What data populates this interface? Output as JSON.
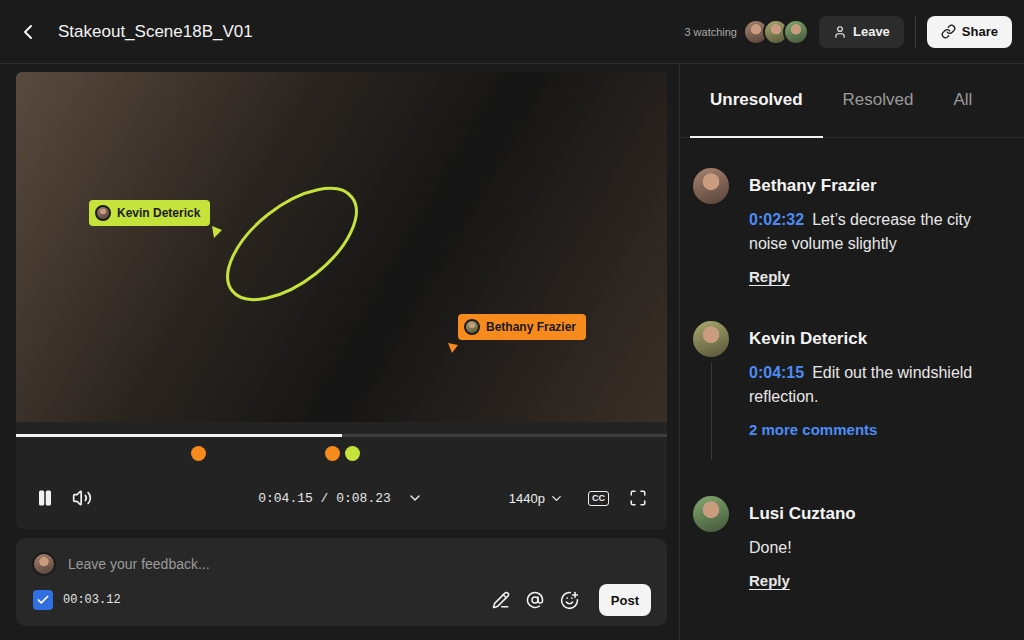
{
  "window": {
    "title": "Stakeout_Scene18B_V01"
  },
  "presence": {
    "label": "3 watching",
    "avatar_count": 3
  },
  "header_buttons": {
    "leave": "Leave",
    "share": "Share"
  },
  "video": {
    "annotations": [
      {
        "author": "Kevin Deterick",
        "color": "#c6e33b",
        "kind": "drawing"
      },
      {
        "author": "Bethany Frazier",
        "color": "#f78a1d",
        "kind": "pin"
      }
    ],
    "progress": {
      "level": 0.5
    },
    "markers": [
      {
        "color": "#f78a1d",
        "level": 0.28
      },
      {
        "color": "#f78a1d",
        "level": 0.485
      },
      {
        "color": "#c6e33b",
        "level": 0.516
      }
    ],
    "playing": true,
    "muted": false,
    "time": "0:04.15 / 0:08.23",
    "quality": "1440p",
    "captions": "CC"
  },
  "feedback": {
    "placeholder": "Leave your feedback...",
    "timestamp_enabled": true,
    "timestamp": "00:03.12",
    "post": "Post"
  },
  "tabs": [
    {
      "label": "Unresolved",
      "selected": true
    },
    {
      "label": "Resolved",
      "selected": false
    },
    {
      "label": "All",
      "selected": false
    }
  ],
  "comments": [
    {
      "author": "Bethany Frazier",
      "time": "0:02:32",
      "text": "Let’s decrease the city noise volume slightly",
      "reply": "Reply",
      "more": "",
      "replies": []
    },
    {
      "author": "Kevin Deterick",
      "time": "0:04:15",
      "text": "Edit out the windshield reflection.",
      "reply": "",
      "more": "2 more comments",
      "replies": [
        {
          "author": "Lusi Cuztano",
          "time": "",
          "text": "Done!",
          "reply": "Reply",
          "more": "",
          "replies": []
        }
      ]
    }
  ]
}
